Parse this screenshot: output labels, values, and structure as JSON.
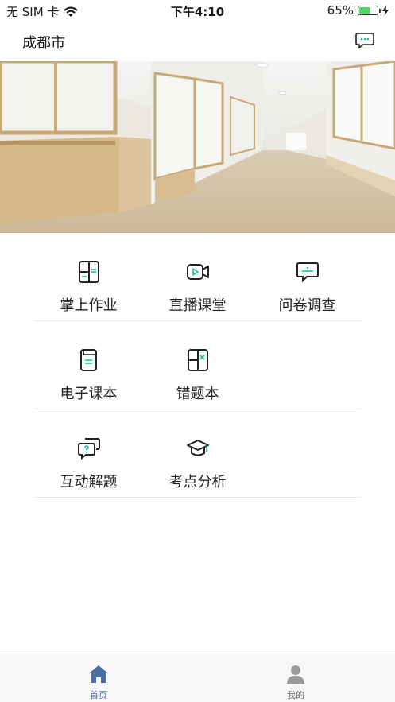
{
  "status_bar": {
    "carrier": "无 SIM 卡",
    "time": "下午4:10",
    "battery": "65%",
    "battery_level": 0.65
  },
  "nav": {
    "city": "成都市",
    "message_icon": "chat-bubble-icon"
  },
  "banner": {
    "image": "school-hallway-photo"
  },
  "colors": {
    "accent": "#1abc9c",
    "tab_active": "#4a6fa5",
    "tab_inactive": "#9a9a9a"
  },
  "features": {
    "homework": {
      "label": "掌上作业",
      "icon": "homework-icon"
    },
    "live": {
      "label": "直播课堂",
      "icon": "video-camera-icon"
    },
    "survey": {
      "label": "问卷调查",
      "icon": "survey-chat-icon"
    },
    "ebook": {
      "label": "电子课本",
      "icon": "ebook-icon"
    },
    "mistakes": {
      "label": "错题本",
      "icon": "mistake-book-icon"
    },
    "qa": {
      "label": "互动解题",
      "icon": "question-chat-icon"
    },
    "analysis": {
      "label": "考点分析",
      "icon": "graduation-cap-icon"
    }
  },
  "tabbar": {
    "home": {
      "label": "首页",
      "icon": "home-icon",
      "active": true
    },
    "mine": {
      "label": "我的",
      "icon": "user-icon",
      "active": false
    }
  }
}
